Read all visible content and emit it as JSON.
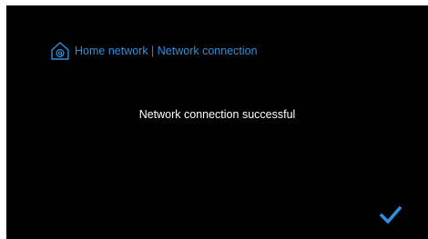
{
  "header": {
    "icon": "home-network-icon",
    "breadcrumb": "Home network | Network connection"
  },
  "main": {
    "status_message": "Network connection successful"
  },
  "actions": {
    "confirm_icon": "checkmark-icon"
  },
  "colors": {
    "background": "#000000",
    "accent": "#2f8fe0",
    "text": "#ffffff",
    "bezel": "#ffffff"
  }
}
